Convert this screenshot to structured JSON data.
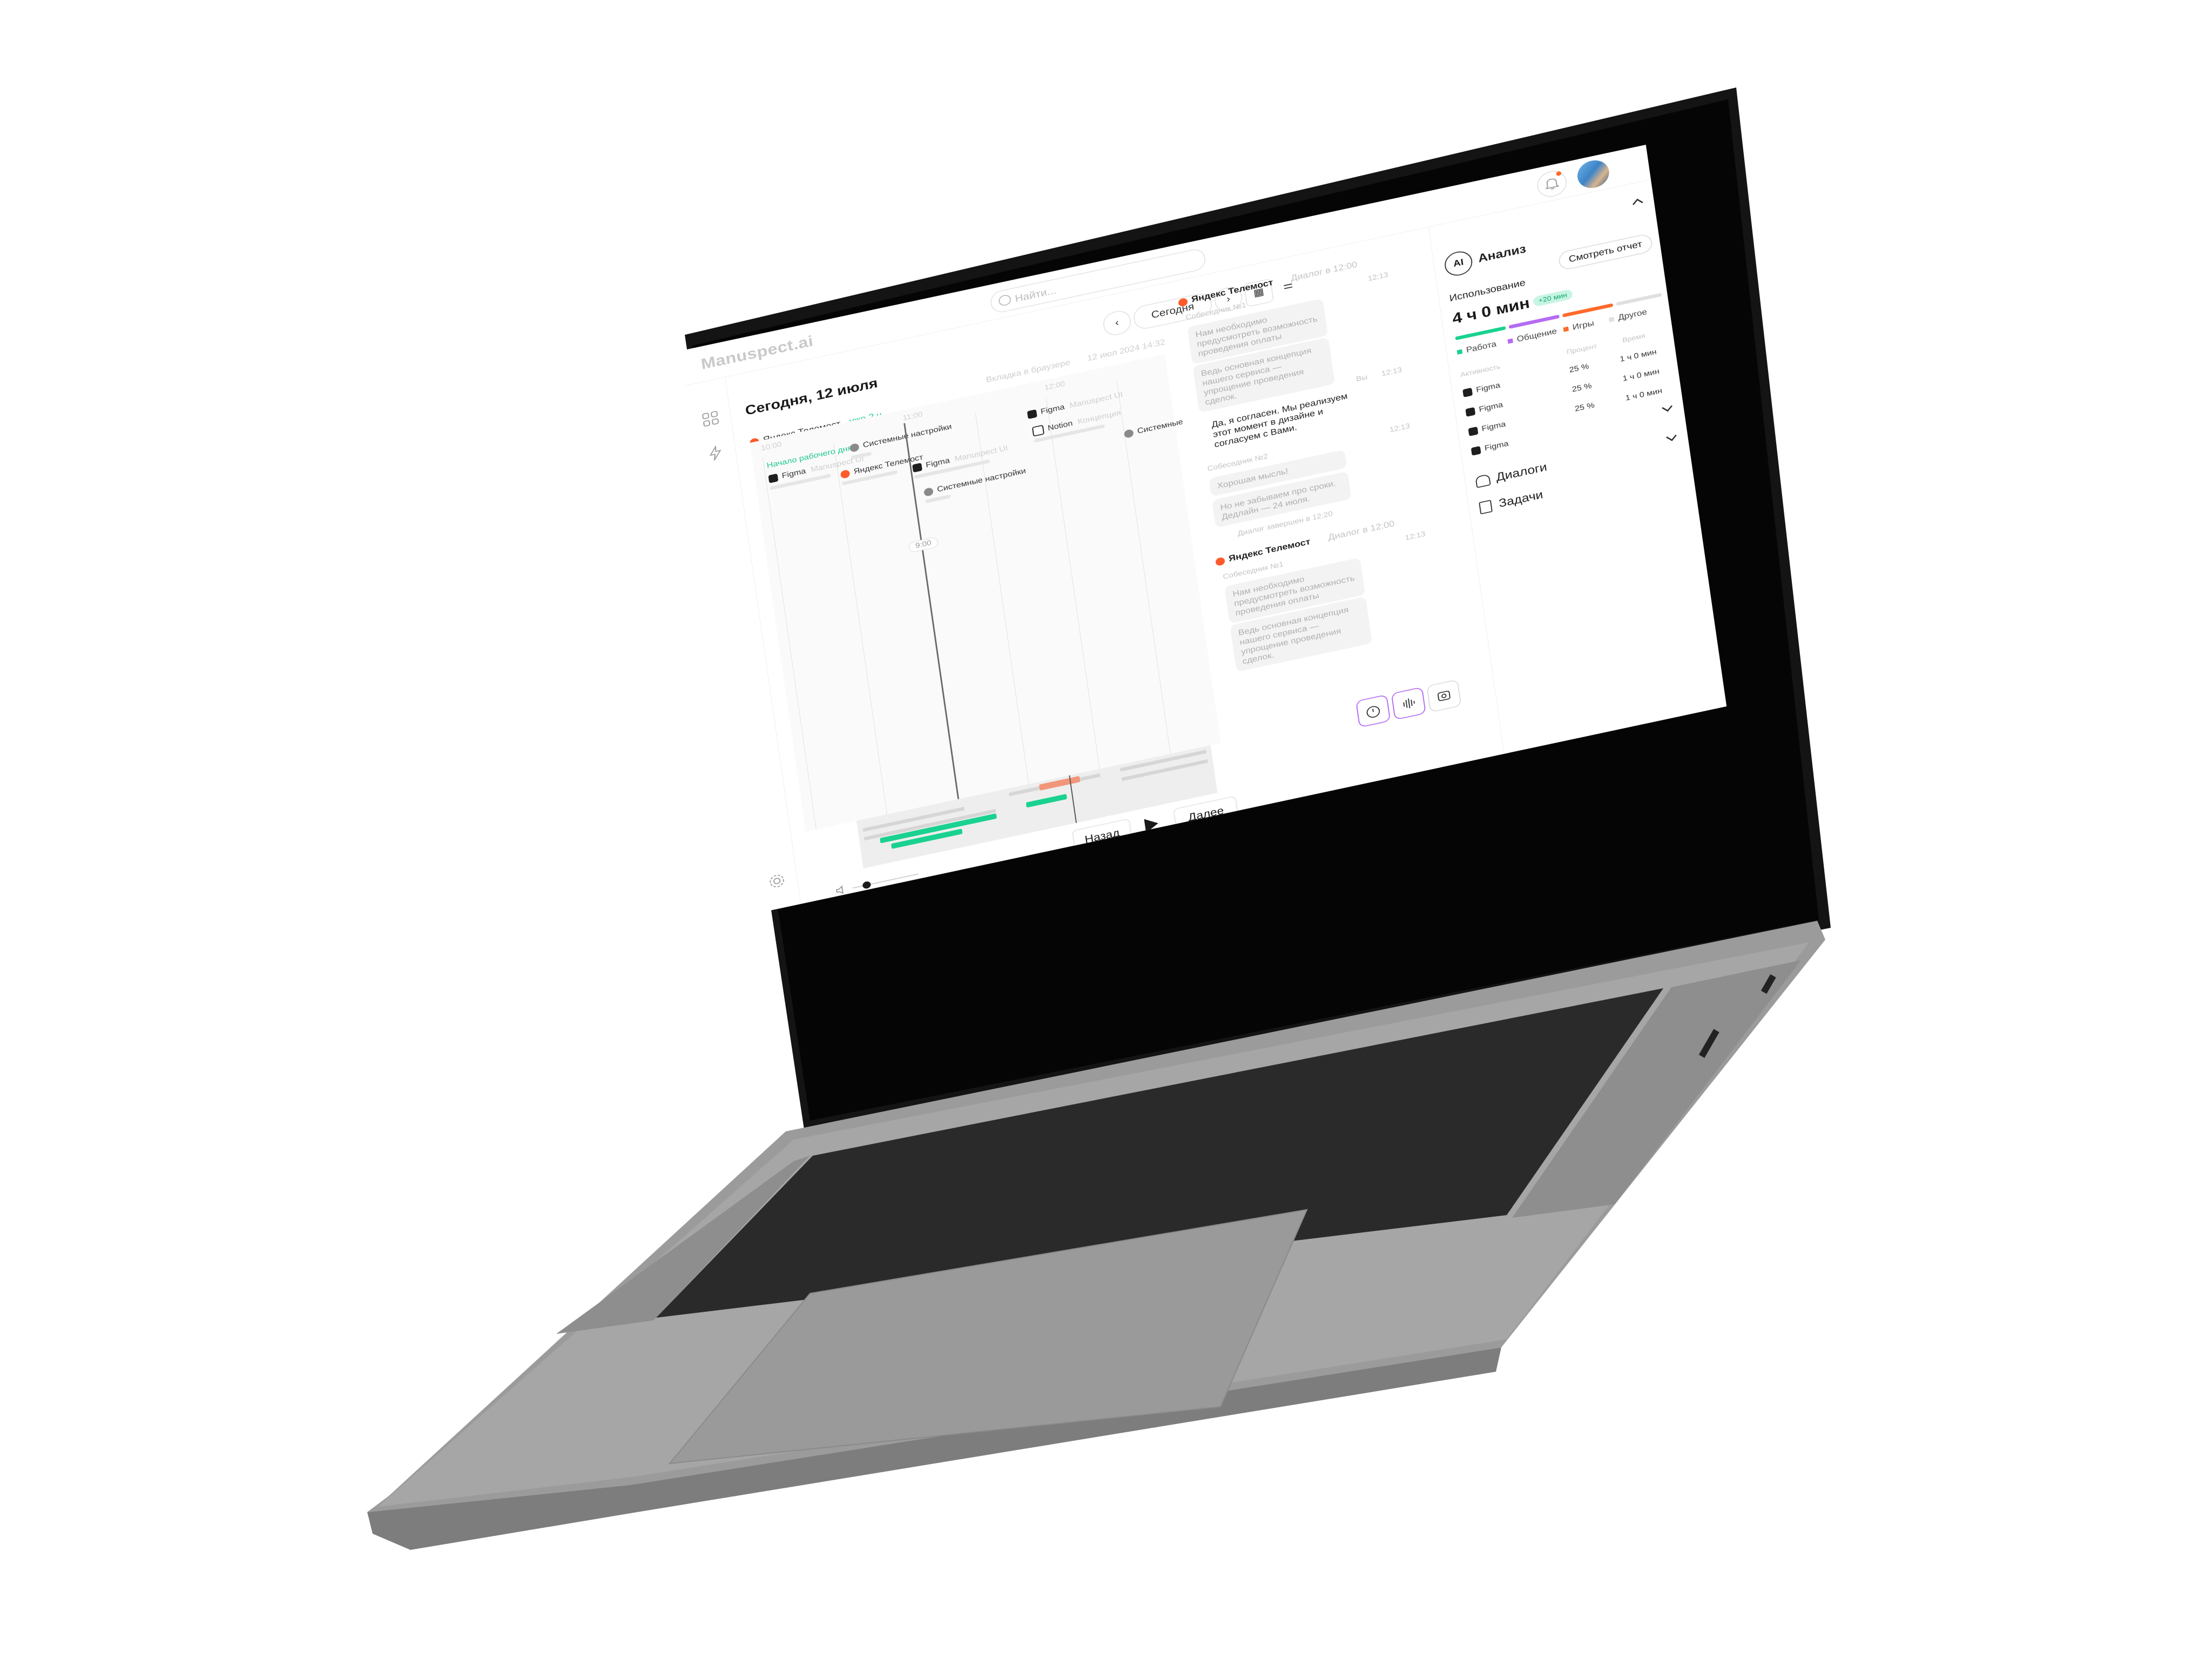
{
  "app": {
    "title": "Manuspect.ai",
    "search_placeholder": "Найти..."
  },
  "toolbar": {
    "today_label": "Сегодня"
  },
  "main": {
    "date_title": "Сегодня, 12 июля",
    "browser_tab_label": "Вкладка в браузере",
    "browser_tab_time": "12 июл 2024 14:32",
    "current_app": "Яндекс Телемост",
    "current_app_status": "уже 2 ч",
    "times": [
      "10:00",
      "11:00",
      "12:00",
      "09:00"
    ],
    "day_start": "Начало рабочего дня",
    "now_pill": "9:00",
    "chips": [
      {
        "app": "Figma",
        "detail": "Manuspect UI"
      },
      {
        "app": "Системные настройки",
        "detail": ""
      },
      {
        "app": "Яндекс Телемост",
        "detail": ""
      },
      {
        "app": "Figma",
        "detail": "Manuspect UI"
      },
      {
        "app": "Системные настройки",
        "detail": ""
      },
      {
        "app": "Figma",
        "detail": "Manuspect UI"
      },
      {
        "app": "Notion",
        "detail": "Концепция"
      },
      {
        "app": "Системные",
        "detail": ""
      }
    ]
  },
  "player": {
    "back_label": "Назад",
    "next_label": "Далее",
    "volume": 0.2
  },
  "chat": {
    "dialog1": {
      "app": "Яндекс Телемост",
      "dialog_time": "Диалог в 12:00",
      "speaker1": "Собеседник №1",
      "time1": "12:13",
      "msg1": "Нам необходимо предусмотреть возможность проведения оплаты",
      "msg2": "Ведь основная концепция нашего сервиса — упрощение проведения сделок.",
      "me_label": "Вы",
      "time2": "12:13",
      "my_reply": "Да, я согласен. Мы реализуем этот момент в дизайне и согласуем с Вами.",
      "speaker2": "Собеседник №2",
      "time3": "12:13",
      "msg3": "Хорошая мысль!",
      "msg4": "Но не забываем про сроки. Дедлайн — 24 июля.",
      "ended": "Диалог завершен в 12:20"
    },
    "dialog2": {
      "app": "Яндекс Телемост",
      "dialog_time": "Диалог в 12:00",
      "speaker1": "Собеседник №1",
      "time1": "12:13",
      "msg1": "Нам необходимо предусмотреть возможность проведения оплаты",
      "msg2": "Ведь основная концепция нашего сервиса — упрощение проведения сделок."
    }
  },
  "panel": {
    "ai_badge": "AI",
    "title": "Анализ",
    "report_button": "Смотреть отчет",
    "usage_label": "Использование",
    "usage_total": "4 ч 0 мин",
    "usage_delta": "+20 мин",
    "legend": [
      "Работа",
      "Общение",
      "Игры",
      "Другое"
    ],
    "colors": {
      "work": "#19d28f",
      "talk": "#b46cf2",
      "games": "#ff6a2b",
      "other": "#e0e0e0"
    },
    "table_headers": [
      "Активность",
      "Процент",
      "Время"
    ],
    "rows": [
      {
        "app": "Figma",
        "percent": "25 %",
        "time": "1 ч 0 мин"
      },
      {
        "app": "Figma",
        "percent": "25 %",
        "time": "1 ч 0 мин"
      },
      {
        "app": "Figma",
        "percent": "25 %",
        "time": "1 ч 0 мин"
      },
      {
        "app": "Figma",
        "percent": "",
        "time": ""
      }
    ],
    "dialogs_label": "Диалоги",
    "tasks_label": "Задачи"
  }
}
